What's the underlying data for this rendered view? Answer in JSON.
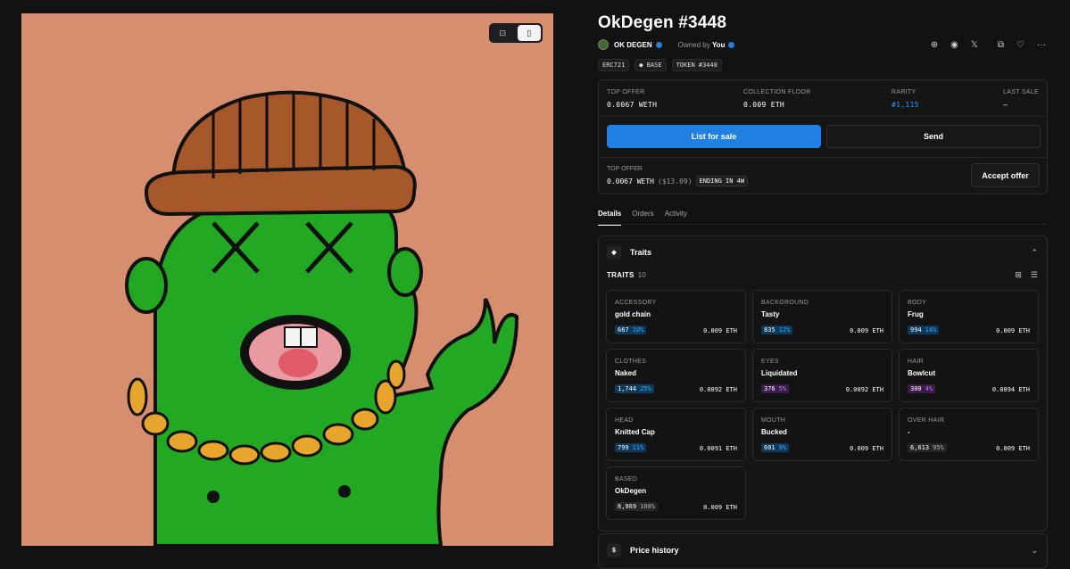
{
  "nft": {
    "title": "OkDegen #3448",
    "collection": "OK DEGEN",
    "owned_prefix": "Owned by",
    "owner": "You",
    "chips": [
      "ERC721",
      "● BASE",
      "TOKEN #3448"
    ]
  },
  "view_toggle": {
    "left": "⊡",
    "right": "▯"
  },
  "header_icons": [
    "globe-icon",
    "discord-icon",
    "x-icon",
    "copy-icon",
    "heart-icon",
    "more-icon"
  ],
  "header_icon_glyphs": {
    "globe": "⊕",
    "discord": "◉",
    "x": "𝕏",
    "copy": "⧉",
    "heart": "♡",
    "more": "···"
  },
  "stats": {
    "top_offer": {
      "label": "TOP OFFER",
      "value": "0.0067 WETH"
    },
    "collection_floor": {
      "label": "COLLECTION FLOOR",
      "value": "0.009 ETH"
    },
    "rarity": {
      "label": "RARITY",
      "value": "#1,115"
    },
    "last_sale": {
      "label": "LAST SALE",
      "value": "–"
    }
  },
  "actions": {
    "list_for_sale": "List for sale",
    "send": "Send",
    "accept_offer": "Accept offer"
  },
  "offer": {
    "label": "TOP OFFER",
    "amount": "0.0067 WETH",
    "usd": "($13.09)",
    "ending": "ENDING IN 4W"
  },
  "tabs": [
    "Details",
    "Orders",
    "Activity"
  ],
  "traits_section": {
    "title": "Traits",
    "icon": "◆",
    "caret": "⌃",
    "label": "TRAITS",
    "count": "10",
    "grid_icon": "⊞",
    "list_icon": "☰"
  },
  "traits": [
    {
      "category": "ACCESSORY",
      "value": "gold chain",
      "count": "667",
      "pct": "10%",
      "price": "0.009 ETH",
      "color": "blue"
    },
    {
      "category": "BACKGROUND",
      "value": "Tasty",
      "count": "835",
      "pct": "12%",
      "price": "0.009 ETH",
      "color": "blue"
    },
    {
      "category": "BODY",
      "value": "Frug",
      "count": "994",
      "pct": "14%",
      "price": "0.009 ETH",
      "color": "blue"
    },
    {
      "category": "CLOTHES",
      "value": "Naked",
      "count": "1,744",
      "pct": "25%",
      "price": "0.0092 ETH",
      "color": "blue"
    },
    {
      "category": "EYES",
      "value": "Liquidated",
      "count": "376",
      "pct": "5%",
      "price": "0.0092 ETH",
      "color": "purple"
    },
    {
      "category": "HAIR",
      "value": "Bowlcut",
      "count": "300",
      "pct": "4%",
      "price": "0.0094 ETH",
      "color": "purple"
    },
    {
      "category": "HEAD",
      "value": "Knitted Cap",
      "count": "799",
      "pct": "11%",
      "price": "0.0091 ETH",
      "color": "blue"
    },
    {
      "category": "MOUTH",
      "value": "Bucked",
      "count": "601",
      "pct": "9%",
      "price": "0.009 ETH",
      "color": "blue"
    },
    {
      "category": "OVER HAIR",
      "value": "-",
      "count": "6,613",
      "pct": "95%",
      "price": "0.009 ETH",
      "color": "gray"
    },
    {
      "category": "BASED",
      "value": "OkDegen",
      "count": "6,969",
      "pct": "100%",
      "price": "0.009 ETH",
      "color": "gray"
    }
  ],
  "price_history": {
    "title": "Price history",
    "icon": "$",
    "caret": "⌄"
  },
  "colors": {
    "accent": "#2081e2",
    "art_bg": "#d68e6e",
    "body": "#1faa1f",
    "hat": "#a7582a"
  }
}
